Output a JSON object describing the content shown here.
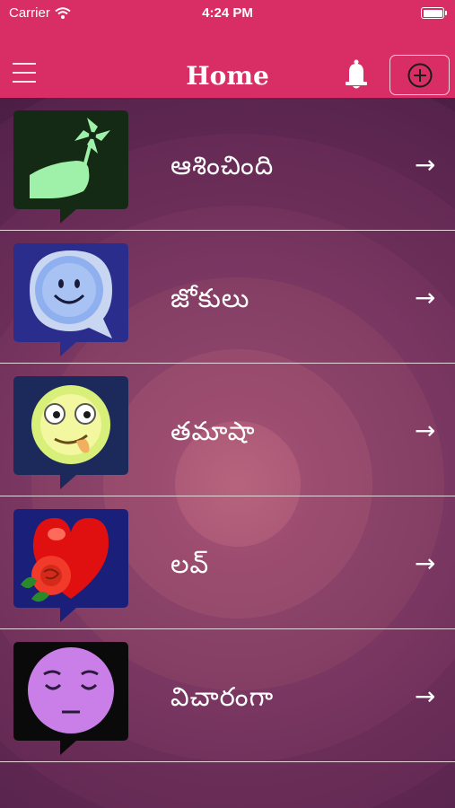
{
  "status_bar": {
    "carrier": "Carrier",
    "time": "4:24 PM"
  },
  "nav": {
    "title": "Home",
    "menu_icon": "hamburger-menu-icon",
    "bell_icon": "bell-icon",
    "add_icon": "plus-circle-icon"
  },
  "colors": {
    "accent": "#d92e65",
    "row_divider": "#e9d3dd"
  },
  "categories": [
    {
      "label": "ఆశించింది",
      "icon": "hand-pinwheel-icon",
      "arrow": "→"
    },
    {
      "label": "జోకులు",
      "icon": "smiley-bubble-icon",
      "arrow": "→"
    },
    {
      "label": "తమాషా",
      "icon": "tongue-out-face-icon",
      "arrow": "→"
    },
    {
      "label": "లవ్",
      "icon": "heart-rose-icon",
      "arrow": "→"
    },
    {
      "label": "విచారంగా",
      "icon": "sad-face-icon",
      "arrow": "→"
    }
  ]
}
